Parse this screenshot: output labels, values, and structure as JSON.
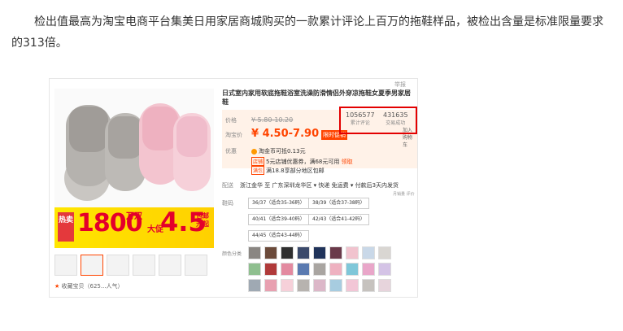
{
  "article": {
    "paragraph": "检出值最高为淘宝电商平台集美日用家居商城购买的一款累计评论上百万的拖鞋样品，被检出含量是标准限量要求的313倍。"
  },
  "product": {
    "report_link": "举报",
    "title": "日式室内家用软底拖鞋浴室洗澡防滑情侣外穿凉拖鞋女夏季男家居鞋",
    "price_label": "价格",
    "old_price": "¥ 5.80-10.20",
    "taobao_price_label": "淘宝价",
    "price": "¥ 4.50-7.90",
    "deal_badge": "限时促销",
    "promo_label": "优惠",
    "coin_text": "淘金币可抵0.13元",
    "tag_shop_coupon": "店铺",
    "coupon_text": "5元店铺优惠券，满68元可用",
    "coupon_link": "领取",
    "tag_promo": "满包",
    "promo_text": "满18.8享部分地区包邮",
    "stats": [
      {
        "num": "1056577",
        "label": "累计评论"
      },
      {
        "num": "431635",
        "label": "交易成功"
      }
    ],
    "add_cart": "加入购物车",
    "ship_label": "配送",
    "ship_text": "浙江金华 至  广东深圳龙华区 ▾   快递 免运费 ▾   付款后3天内发货",
    "ship_note": "月销量 评价",
    "size_label": "鞋码",
    "sizes": [
      "36/37（适合35-36码）",
      "38/39（适合37-38码）",
      "40/41（适合39-40码）",
      "42/43（适合41-42码）",
      "44/45（适合43-44码）"
    ],
    "color_label": "颜色分类",
    "favorite": "收藏宝贝（625...人气）",
    "banner": {
      "hot": "热卖",
      "count": "1800",
      "unit": "万双",
      "promo": "大促",
      "price": "4.5",
      "ship": "包邮元起"
    }
  },
  "colors": {
    "accent": "#ff4400",
    "highlight_box": "#e30000",
    "price_bg": "#fff2e8"
  }
}
